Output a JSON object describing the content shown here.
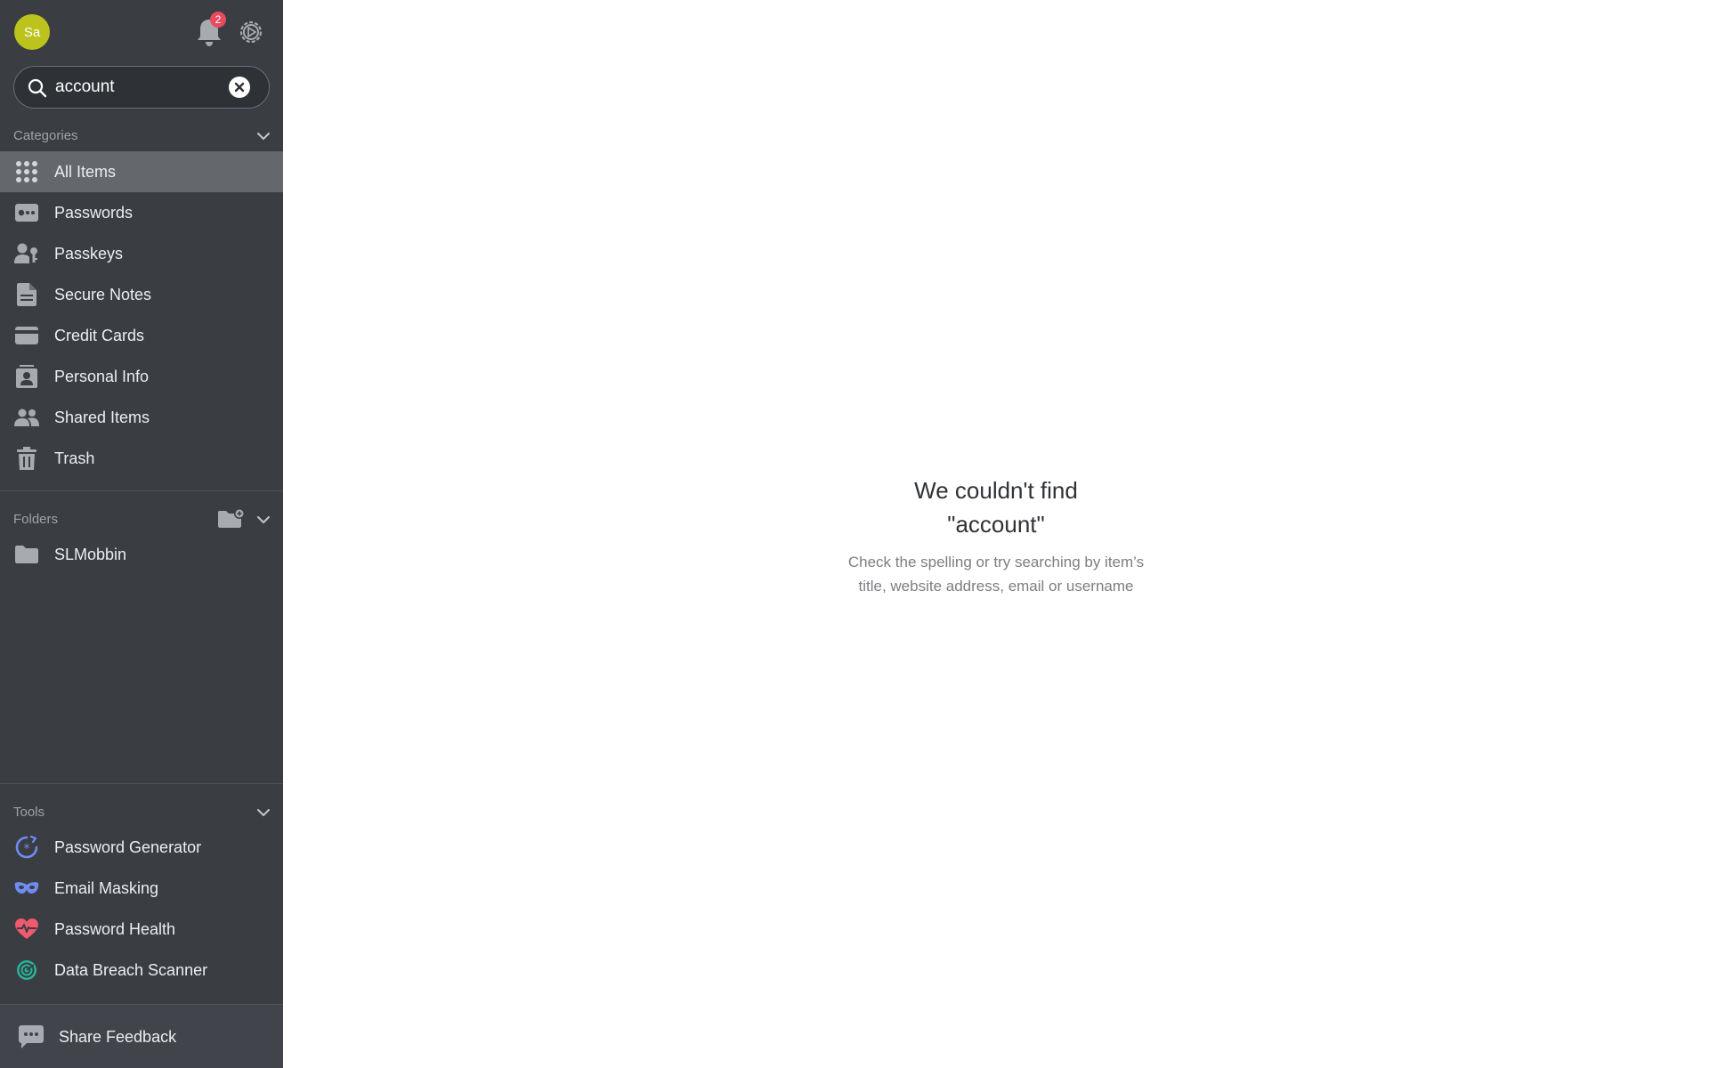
{
  "header": {
    "avatar_initials": "Sa",
    "notification_count": "2"
  },
  "search": {
    "value": "account",
    "placeholder": "Search"
  },
  "categories": {
    "title": "Categories",
    "items": [
      {
        "label": "All Items",
        "icon": "grid-icon"
      },
      {
        "label": "Passwords",
        "icon": "password-card-icon"
      },
      {
        "label": "Passkeys",
        "icon": "passkey-icon"
      },
      {
        "label": "Secure Notes",
        "icon": "note-icon"
      },
      {
        "label": "Credit Cards",
        "icon": "credit-card-icon"
      },
      {
        "label": "Personal Info",
        "icon": "id-badge-icon"
      },
      {
        "label": "Shared Items",
        "icon": "shared-users-icon"
      },
      {
        "label": "Trash",
        "icon": "trash-icon"
      }
    ]
  },
  "folders": {
    "title": "Folders",
    "items": [
      {
        "label": "SLMobbin",
        "icon": "folder-icon"
      }
    ]
  },
  "tools": {
    "title": "Tools",
    "items": [
      {
        "label": "Password Generator",
        "icon": "password-generator-icon"
      },
      {
        "label": "Email Masking",
        "icon": "mask-icon"
      },
      {
        "label": "Password Health",
        "icon": "heart-pulse-icon"
      },
      {
        "label": "Data Breach Scanner",
        "icon": "radar-icon"
      }
    ]
  },
  "footer": {
    "feedback_label": "Share Feedback"
  },
  "empty_state": {
    "title_line1": "We couldn't find",
    "title_line2": "\"account\"",
    "desc_line1": "Check the spelling or try searching by item’s",
    "desc_line2": "title, website address, email or username"
  },
  "colors": {
    "sidebar_bg": "#3a3d42",
    "active_item_bg": "#64676c",
    "badge_red": "#e84a5f",
    "avatar_green": "#bcc31d",
    "tool_blue": "#6f8cf0",
    "tool_red": "#f05a6e",
    "tool_teal": "#27b59a"
  }
}
